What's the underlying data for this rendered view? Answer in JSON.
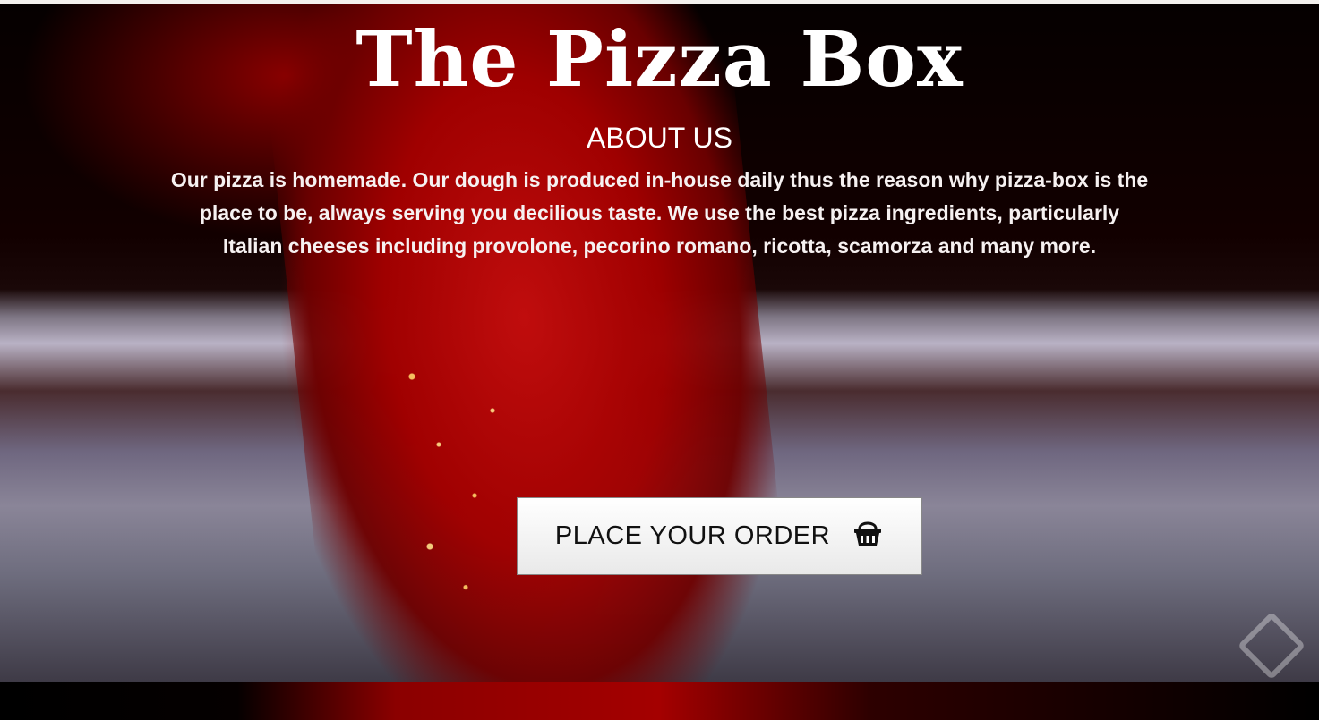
{
  "hero": {
    "title": "The Pizza Box",
    "subtitle": "ABOUT US",
    "about_text": "Our pizza is homemade. Our dough is produced in-house daily thus the reason why pizza-box is the place to be, always serving you decilious taste. We use the best pizza ingredients, particularly Italian cheeses including provolone, pecorino romano, ricotta, scamorza and many more."
  },
  "order_button": {
    "label": "PLACE YOUR ORDER",
    "icon": "basket-icon"
  },
  "colors": {
    "title_text": "#ffffff",
    "button_bg": "#f2f2f2",
    "button_text": "#111111",
    "accent_red": "#a40000"
  }
}
